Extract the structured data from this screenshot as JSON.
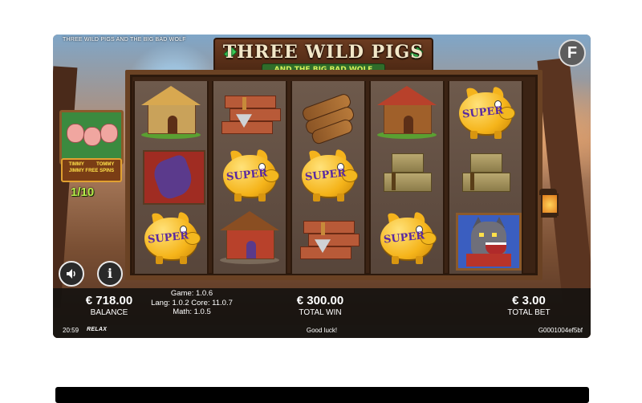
{
  "game": {
    "small_title": "THREE WILD PIGS AND THE BIG BAD WOLF",
    "logo_title": "THREE WILD PIGS",
    "logo_subtitle": "AND THE BIG BAD WOLF",
    "fast_button": "F"
  },
  "free_spins": {
    "names_left": "TIMMY",
    "names_right": "TOMMY",
    "label": "JIMMY FREE SPINS",
    "count": "1/10"
  },
  "reels": {
    "symbol_label": "SUPER",
    "grid": [
      [
        "straw-house",
        "claw",
        "piggy-bank"
      ],
      [
        "bricks",
        "piggy-bank",
        "brick-house"
      ],
      [
        "logs",
        "piggy-bank",
        "bricks"
      ],
      [
        "wood-house",
        "hay-bales",
        "piggy-bank"
      ],
      [
        "piggy-bank",
        "hay-bales",
        "wolf"
      ]
    ]
  },
  "controls": {
    "sound_icon": "speaker-icon",
    "info_label": "i"
  },
  "bottom": {
    "balance_value": "€ 718.00",
    "balance_label": "BALANCE",
    "version_game": "Game: 1.0.6",
    "version_lang_core": "Lang: 1.0.2 Core: 11.0.7",
    "version_math": "Math: 1.0.5",
    "win_value": "€ 300.00",
    "win_label": "TOTAL WIN",
    "bet_value": "€ 3.00",
    "bet_label": "TOTAL BET"
  },
  "status": {
    "clock": "20:59",
    "brand": "RELAX",
    "message": "Good luck!",
    "session_id": "G0001004ef5bf"
  },
  "colors": {
    "win_green": "#b8ec4a",
    "piggy_gold": "#f5b41a",
    "super_purple": "#5a2aa0"
  }
}
